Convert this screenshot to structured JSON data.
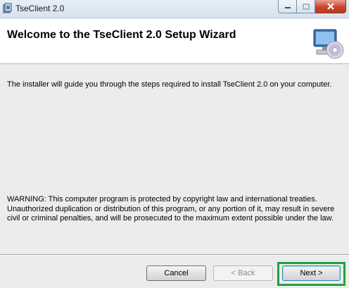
{
  "window": {
    "title": "TseClient 2.0",
    "icon": "installer-app-icon"
  },
  "titlebar_buttons": {
    "minimize": "minimize-icon",
    "maximize": "maximize-icon",
    "close": "close-icon"
  },
  "banner": {
    "title": "Welcome to the TseClient 2.0 Setup Wizard",
    "graphic": "computer-cd-icon"
  },
  "body": {
    "intro": "The installer will guide you through the steps required to install TseClient 2.0 on your computer.",
    "warning": "WARNING: This computer program is protected by copyright law and international treaties. Unauthorized duplication or distribution of this program, or any portion of it, may result in severe civil or criminal penalties, and will be prosecuted to the maximum extent possible under the law."
  },
  "buttons": {
    "cancel": "Cancel",
    "back": "< Back",
    "next": "Next >"
  },
  "colors": {
    "highlight_frame": "#1fa53a",
    "close_button": "#c9462c"
  }
}
